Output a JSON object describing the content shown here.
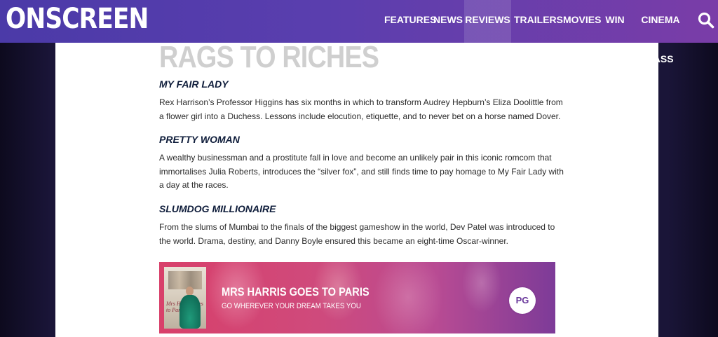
{
  "header": {
    "logo": "ONSCREEN",
    "nav": [
      {
        "label": "FEATURES"
      },
      {
        "label": "NEWS"
      },
      {
        "label": "REVIEWS",
        "active": true
      },
      {
        "label": "TRAILERS"
      },
      {
        "label": "MOVIES"
      },
      {
        "label": "WIN"
      },
      {
        "label": "CINEMA PASS"
      }
    ],
    "search_icon": "search-icon"
  },
  "article": {
    "heading": "RAGS TO RICHES",
    "sections": [
      {
        "title": "MY FAIR LADY",
        "body": "Rex Harrison’s Professor Higgins has six months in which to transform Audrey Hepburn’s Eliza Doolittle from a flower girl into a Duchess. Lessons include elocution, etiquette, and to never bet on a horse named Dover."
      },
      {
        "title": "PRETTY WOMAN",
        "body": "A wealthy businessman and a prostitute fall in love and become an unlikely pair in this iconic romcom that immortalises Julia Roberts, introduces the “silver fox”, and still finds time to pay homage to My Fair Lady with a day at the races."
      },
      {
        "title": "SLUMDOG MILLIONAIRE",
        "body": "From the slums of Mumbai to the finals of the biggest gameshow in the world, Dev Patel was introduced to the world. Drama, destiny, and Danny Boyle ensured this became an eight-time Oscar-winner."
      }
    ]
  },
  "promo": {
    "title": "MRS HARRIS GOES TO PARIS",
    "tagline": "GO WHEREVER YOUR DREAM TAKES YOU",
    "rating": "PG",
    "poster_text": "Mrs Harris goes to Paris"
  },
  "colors": {
    "nav_gradient_start": "#4b3aa8",
    "nav_gradient_end": "#7a3da8",
    "heading_gray": "#cfcfcf",
    "subheading_navy": "#0e1c3a",
    "banner_start": "#d8406a",
    "banner_end": "#7d3b98"
  }
}
